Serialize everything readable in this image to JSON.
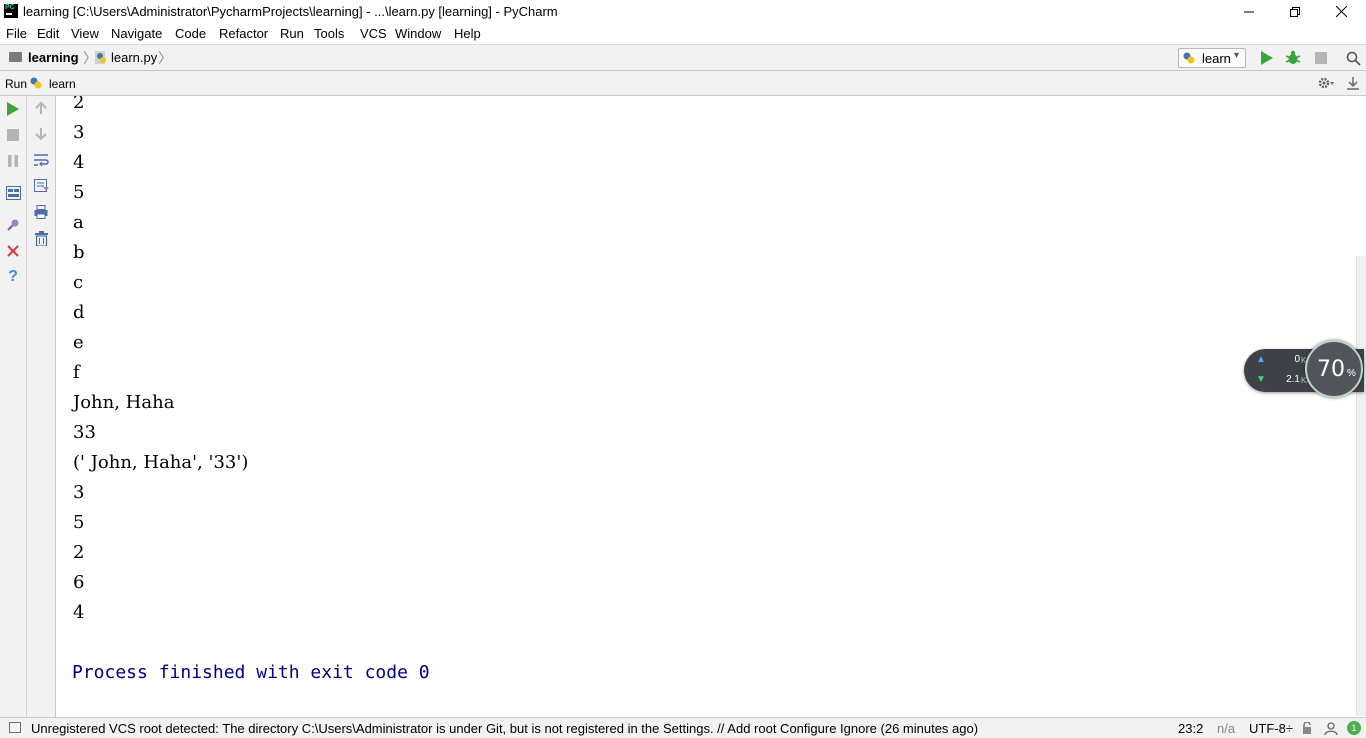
{
  "window": {
    "title": "learning [C:\\Users\\Administrator\\PycharmProjects\\learning] - ...\\learn.py [learning] - PyCharm"
  },
  "menu": [
    {
      "label": "File"
    },
    {
      "label": "Edit"
    },
    {
      "label": "View"
    },
    {
      "label": "Navigate"
    },
    {
      "label": "Code"
    },
    {
      "label": "Refactor"
    },
    {
      "label": "Run"
    },
    {
      "label": "Tools"
    },
    {
      "label": "VCS"
    },
    {
      "label": "Window"
    },
    {
      "label": "Help"
    }
  ],
  "navbar": {
    "project": "learning",
    "file": "learn.py",
    "run_config": "learn"
  },
  "run_panel": {
    "tab_label": "Run",
    "tab_name": "learn"
  },
  "console": {
    "lines": [
      "2",
      "3",
      "4",
      "5",
      "a",
      "b",
      "c",
      "d",
      "e",
      "f",
      "John, Haha",
      "33",
      "(' John, Haha', '33')",
      "3",
      "5",
      "2",
      "6",
      "4"
    ],
    "process_message": "Process finished with exit code 0"
  },
  "net_widget": {
    "upload": "0",
    "download": "2.1",
    "unit": "K/s",
    "cpu_percent": "70",
    "cpu_unit": "%"
  },
  "statusbar": {
    "message": "Unregistered VCS root detected: The directory C:\\Users\\Administrator is under Git, but is not registered in the Settings. // Add root  Configure  Ignore (26 minutes ago)",
    "position": "23:2",
    "na": "n/a",
    "encoding": "UTF-8÷",
    "event_count": "1"
  },
  "colors": {
    "process_text": "#000080",
    "run_green": "#3aa63a",
    "stop_red": "#d9363e",
    "help_blue": "#3b8eea"
  }
}
